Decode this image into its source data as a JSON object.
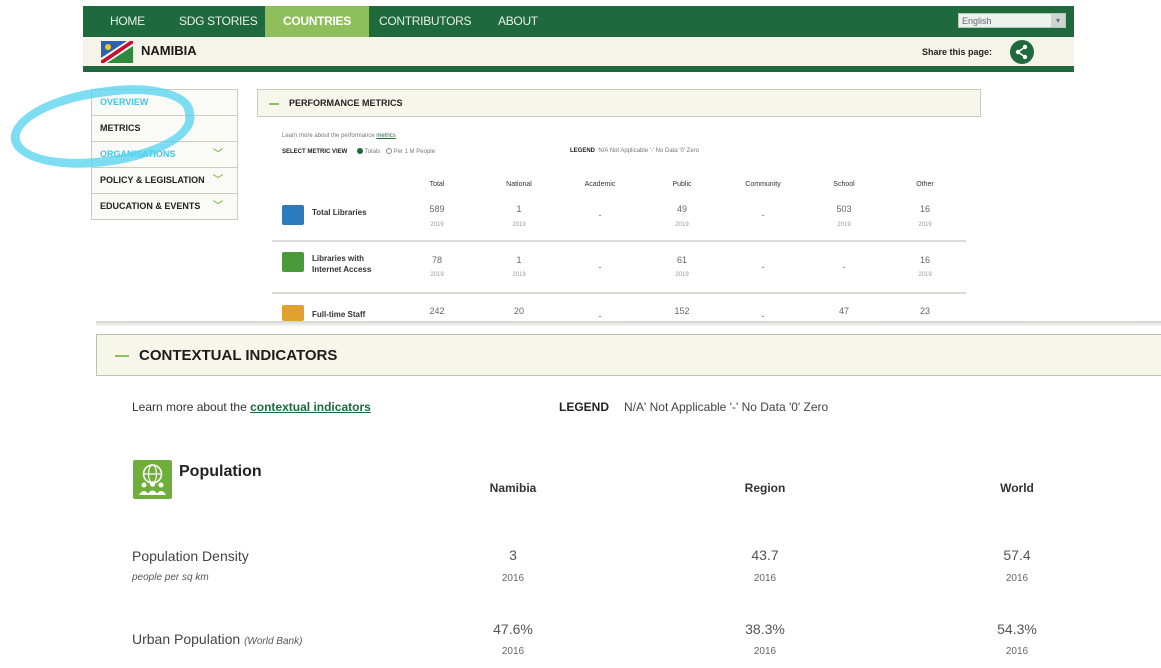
{
  "nav": {
    "items": [
      "HOME",
      "SDG STORIES",
      "COUNTRIES",
      "CONTRIBUTORS",
      "ABOUT"
    ],
    "active": "COUNTRIES",
    "language": "English"
  },
  "country": {
    "name": "NAMIBIA",
    "share_label": "Share this page:"
  },
  "left_menu": {
    "items": [
      "OVERVIEW",
      "METRICS",
      "ORGANISATIONS",
      "POLICY & LEGISLATION",
      "EDUCATION & EVENTS"
    ]
  },
  "performance": {
    "title": "PERFORMANCE METRICS",
    "learn_text": "Learn more about the performance",
    "learn_link": "metrics",
    "select_label": "SELECT METRIC VIEW",
    "opt1": "Totals",
    "opt2": "Per 1 M People",
    "legend_label": "LEGEND",
    "legend_text": "N/A Not Applicable '-' No Data '0' Zero",
    "columns": [
      "Total",
      "National",
      "Academic",
      "Public",
      "Community",
      "School",
      "Other"
    ],
    "rows": [
      {
        "label": "Total Libraries",
        "values": [
          "589",
          "1",
          "-",
          "49",
          "-",
          "503",
          "16"
        ],
        "years": [
          "2019",
          "2019",
          "",
          "2019",
          "",
          "2019",
          "2019"
        ]
      },
      {
        "label": "Libraries with Internet Access",
        "values": [
          "78",
          "1",
          "-",
          "61",
          "-",
          "-",
          "16"
        ],
        "years": [
          "2019",
          "2019",
          "",
          "2019",
          "",
          "",
          "2019"
        ]
      },
      {
        "label": "Full-time Staff",
        "values": [
          "242",
          "20",
          "-",
          "152",
          "-",
          "47",
          "23"
        ]
      }
    ]
  },
  "contextual": {
    "title": "CONTEXTUAL INDICATORS",
    "learn_text": "Learn more about the",
    "learn_link": "contextual indicators",
    "legend_label": "LEGEND",
    "legend_text": "N/A' Not Applicable '-' No Data '0' Zero",
    "section_title": "Population",
    "columns": [
      "Namibia",
      "Region",
      "World"
    ],
    "indicators": [
      {
        "label": "Population Density",
        "sub": "people per sq km",
        "values": [
          "3",
          "43.7",
          "57.4"
        ],
        "years": [
          "2016",
          "2016",
          "2016"
        ]
      },
      {
        "label": "Urban Population",
        "source": "(World Bank)",
        "values": [
          "47.6%",
          "38.3%",
          "54.3%"
        ],
        "years": [
          "2016",
          "2016",
          "2016"
        ]
      }
    ]
  },
  "colors": {
    "brand_green": "#1e6a3c",
    "accent_green": "#8fbf5a",
    "highlight_cyan": "#52d2ef"
  }
}
